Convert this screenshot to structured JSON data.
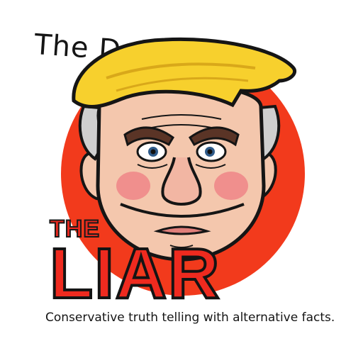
{
  "masthead": {
    "text": "The Daily"
  },
  "headline": {
    "kicker": "THE",
    "title": "LIAR"
  },
  "tagline": {
    "text": "Conservative truth telling with alternative facts."
  },
  "colors": {
    "sun": "#f23a1c",
    "hair": "#f7d02d",
    "skin": "#f4c7ad",
    "cheek": "#f08f8d",
    "headline": "#ef2a1f",
    "outline": "#151515",
    "background": "#ffffff"
  }
}
